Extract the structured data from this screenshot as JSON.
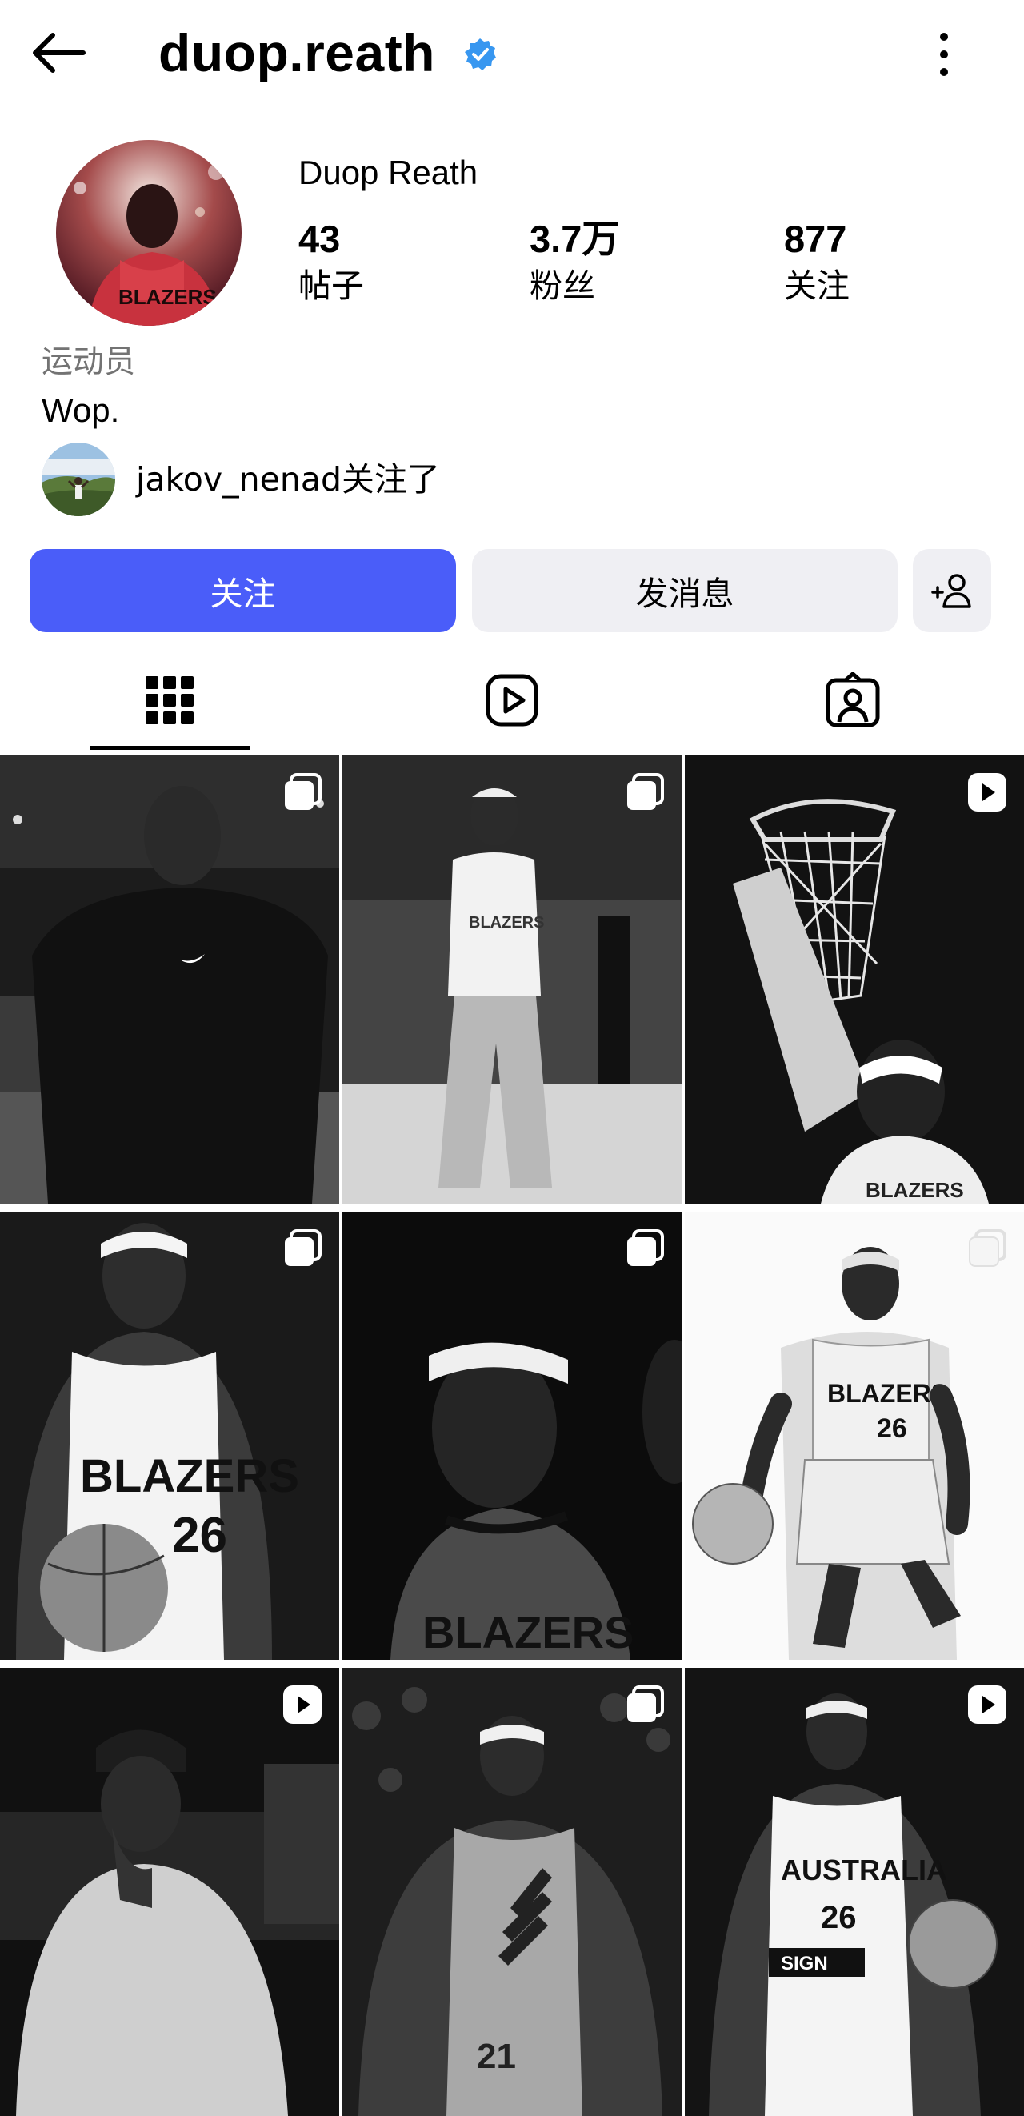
{
  "header": {
    "back_icon": "arrow-left-icon",
    "username": "duop.reath",
    "verified_icon": "verified-badge-icon",
    "more_icon": "more-vertical-icon"
  },
  "profile": {
    "full_name": "Duop Reath",
    "stats": [
      {
        "value": "43",
        "label": "帖子"
      },
      {
        "value": "3.7万",
        "label": "粉丝"
      },
      {
        "value": "877",
        "label": "关注"
      }
    ],
    "category": "运动员",
    "bio": "Wop.",
    "followed_by_text": "jakov_nenad关注了"
  },
  "actions": {
    "follow_label": "关注",
    "message_label": "发消息",
    "suggest_icon": "add-person-icon"
  },
  "tabs": [
    {
      "icon": "grid-icon",
      "active": true
    },
    {
      "icon": "reels-icon",
      "active": false
    },
    {
      "icon": "tagged-icon",
      "active": false
    }
  ],
  "posts": [
    {
      "badge": "carousel-icon"
    },
    {
      "badge": "carousel-icon"
    },
    {
      "badge": "reel-icon"
    },
    {
      "badge": "carousel-icon"
    },
    {
      "badge": "carousel-icon"
    },
    {
      "badge": "carousel-icon"
    },
    {
      "badge": "reel-icon"
    },
    {
      "badge": "carousel-icon"
    },
    {
      "badge": "reel-icon"
    }
  ],
  "colors": {
    "accent": "#4a5df9",
    "verified": "#3897f0",
    "secondary_button": "#efeff3",
    "muted_text": "#737373"
  }
}
